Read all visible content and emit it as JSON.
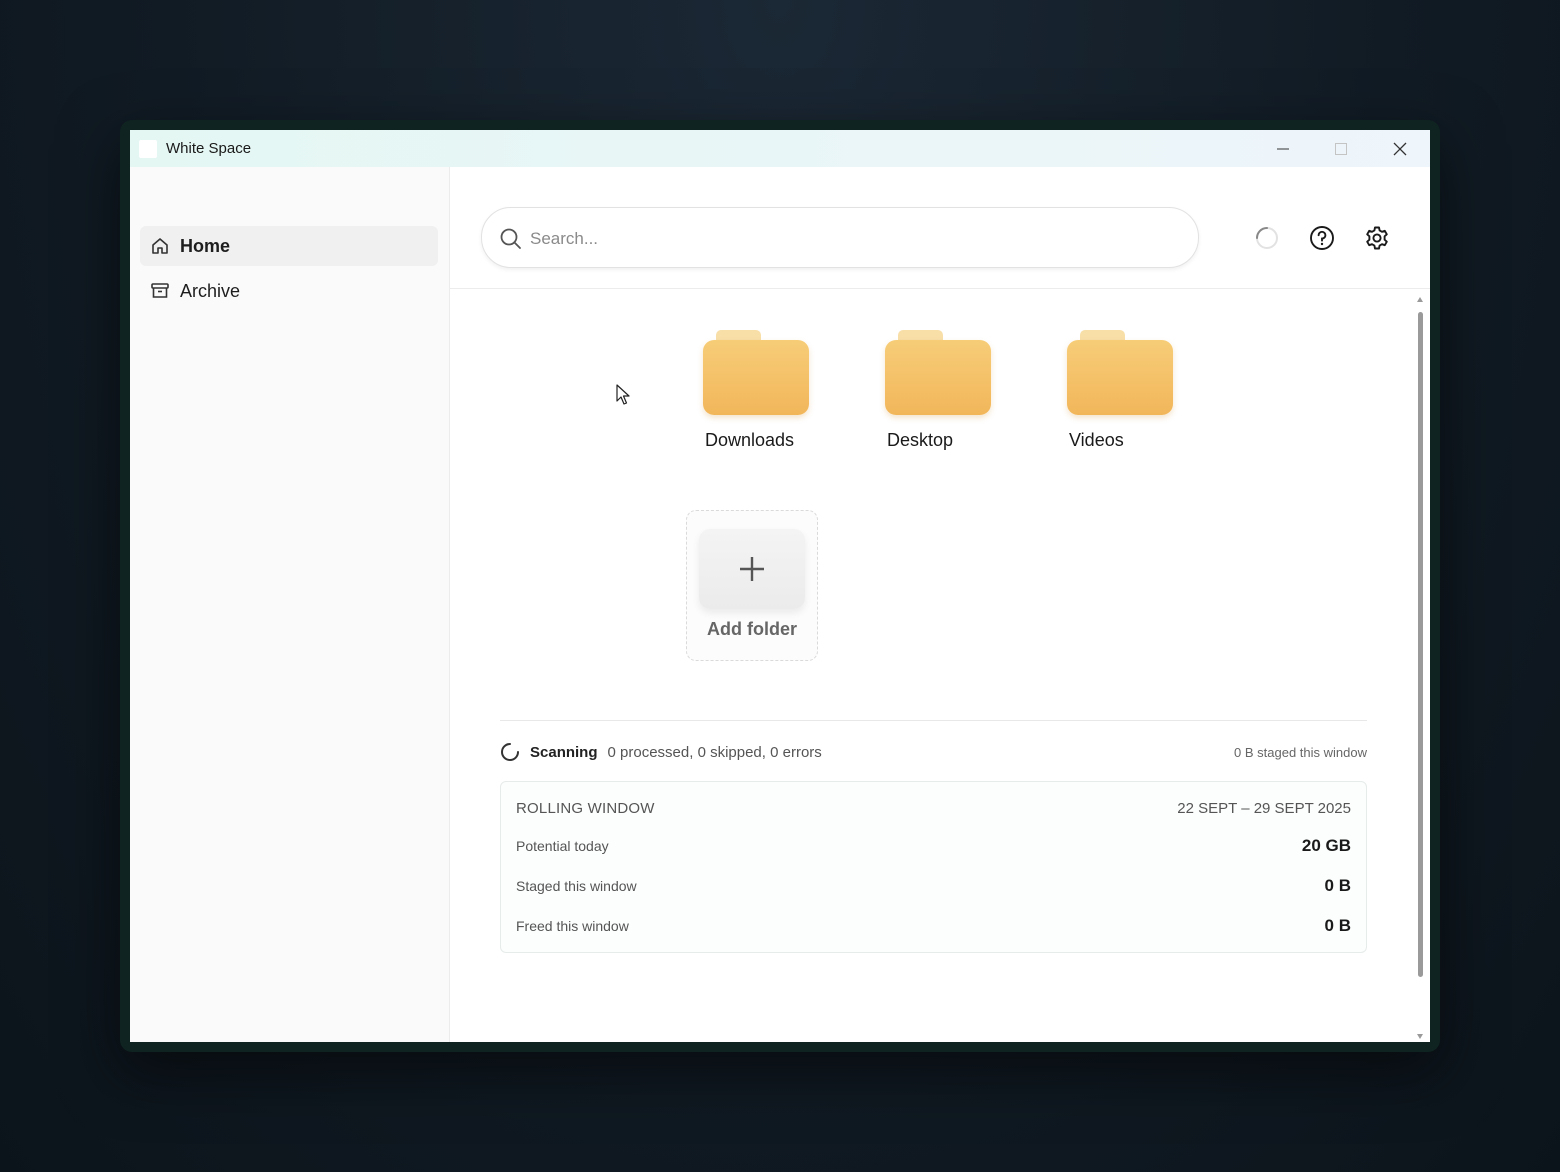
{
  "window": {
    "title": "White Space"
  },
  "sidebar": {
    "items": [
      {
        "label": "Home",
        "icon": "home-icon",
        "active": true
      },
      {
        "label": "Archive",
        "icon": "archive-icon",
        "active": false
      }
    ]
  },
  "search": {
    "placeholder": "Search...",
    "value": ""
  },
  "toolbar": {
    "icons": [
      "loading-spinner-icon",
      "help-icon",
      "gear-icon"
    ]
  },
  "folders": [
    {
      "label": "Downloads",
      "icon": "folder-icon"
    },
    {
      "label": "Desktop",
      "icon": "folder-icon"
    },
    {
      "label": "Videos",
      "icon": "folder-icon"
    }
  ],
  "add_folder": {
    "label": "Add folder",
    "icon": "plus-icon"
  },
  "status": {
    "state": "Scanning",
    "counts": "0 processed, 0 skipped, 0 errors",
    "staged_note": "0 B staged this window"
  },
  "rolling_window": {
    "title": "ROLLING WINDOW",
    "date_range": "22 SEPT – 29 SEPT 2025",
    "rows": [
      {
        "label": "Potential today",
        "value": "20 GB"
      },
      {
        "label": "Staged this window",
        "value": "0 B"
      },
      {
        "label": "Freed this window",
        "value": "0 B"
      }
    ]
  },
  "colors": {
    "folder": "#f4bf65",
    "folder_tab": "#f8dfa8",
    "titlebar": "#e4f7f3",
    "accent_text": "#1a1a1a"
  }
}
